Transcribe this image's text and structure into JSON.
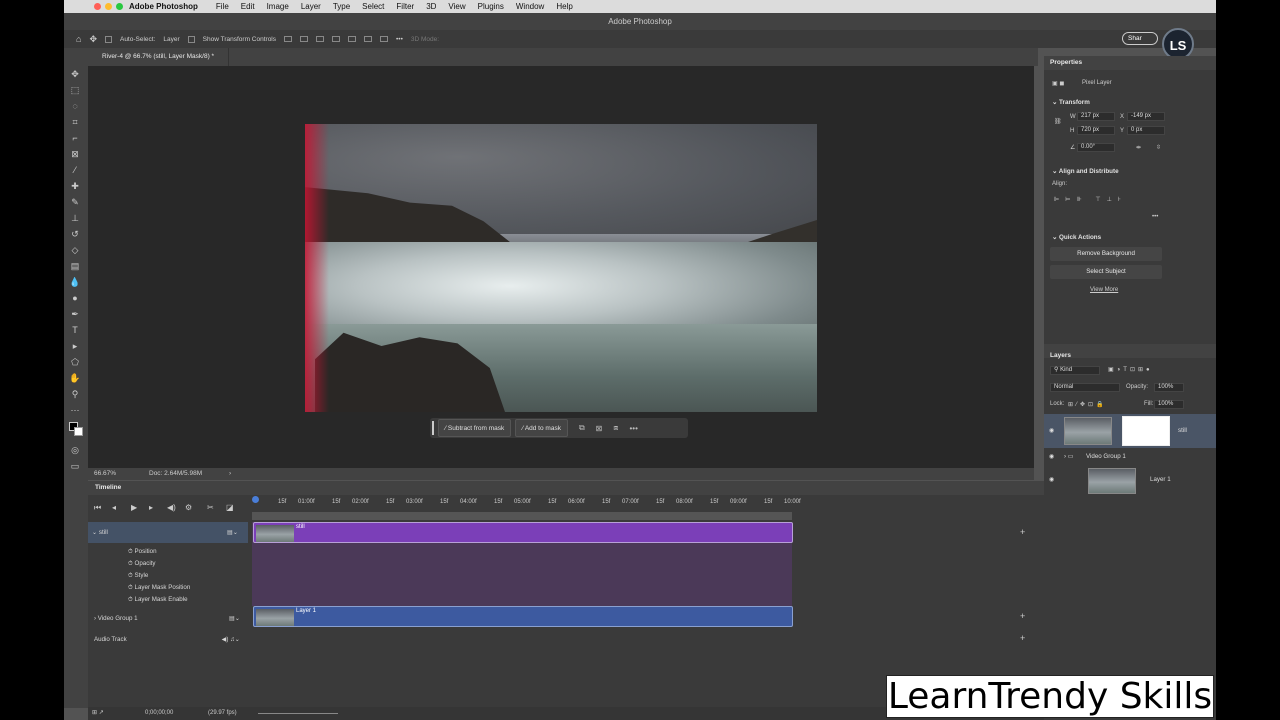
{
  "menubar": {
    "app_name": "Adobe Photoshop",
    "items": [
      "File",
      "Edit",
      "Image",
      "Layer",
      "Type",
      "Select",
      "Filter",
      "3D",
      "View",
      "Plugins",
      "Window",
      "Help"
    ],
    "traffic_colors": [
      "#ff5f57",
      "#febc2e",
      "#28c840"
    ]
  },
  "window_title": "Adobe Photoshop",
  "options": {
    "auto_select_label": "Auto-Select:",
    "auto_select_value": "Layer",
    "transform_label": "Show Transform Controls",
    "mode_3d": "3D Mode:",
    "share_label": "Shar"
  },
  "logo_text": "LS",
  "document_tab": "River-4 @ 66.7% (still, Layer Mask/8) *",
  "context_bar": {
    "subtract": "Subtract from mask",
    "add": "Add to mask"
  },
  "status": {
    "zoom": "66.67%",
    "doc": "Doc: 2.64M/5.98M"
  },
  "timeline": {
    "title": "Timeline",
    "ruler": [
      "15f",
      "01:00f",
      "15f",
      "02:00f",
      "15f",
      "03:00f",
      "15f",
      "04:00f",
      "15f",
      "05:00f",
      "15f",
      "06:00f",
      "15f",
      "07:00f",
      "15f",
      "08:00f",
      "15f",
      "09:00f",
      "15f",
      "10:00f"
    ],
    "layers": {
      "still": "still",
      "props": [
        "Position",
        "Opacity",
        "Style",
        "Layer Mask Position",
        "Layer Mask Enable"
      ],
      "video_group": "Video Group 1",
      "audio": "Audio Track",
      "clip_still": "still",
      "clip_layer1": "Layer 1"
    },
    "timecode": "0;00;00;00",
    "fps": "(29.97 fps)",
    "colors": {
      "still_clip": "#7b3fb8",
      "layer1_clip": "#3d5aa0"
    }
  },
  "properties": {
    "title": "Properties",
    "layer_type": "Pixel Layer",
    "transform": "Transform",
    "w_label": "W",
    "w": "217 px",
    "h_label": "H",
    "h": "720 px",
    "x_label": "X",
    "x": "-149 px",
    "y_label": "Y",
    "y": "0 px",
    "angle": "0.00°",
    "align": "Align and Distribute",
    "align_label": "Align:",
    "quick_actions": "Quick Actions",
    "remove_bg": "Remove Background",
    "select_subject": "Select Subject",
    "view_more": "View More"
  },
  "layers_panel": {
    "title": "Layers",
    "kind": "Kind",
    "blend": "Normal",
    "opacity_label": "Opacity:",
    "opacity": "100%",
    "lock_label": "Lock:",
    "fill_label": "Fill:",
    "fill": "100%",
    "items": [
      "still",
      "Video Group 1",
      "Layer 1"
    ]
  },
  "watermark": "LearnTrendy Skills"
}
